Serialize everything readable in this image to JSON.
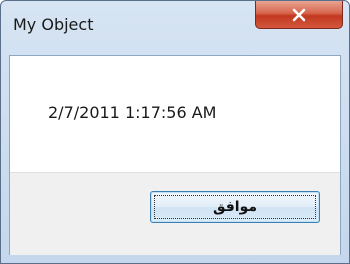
{
  "window": {
    "title": "My Object",
    "close_icon": "close-icon"
  },
  "dialog": {
    "message": "2/7/2011 1:17:56 AM",
    "ok_label": "موافق"
  },
  "colors": {
    "close_button": "#c2391f",
    "frame": "#c5d7ec",
    "button_border": "#3c7fb1"
  }
}
